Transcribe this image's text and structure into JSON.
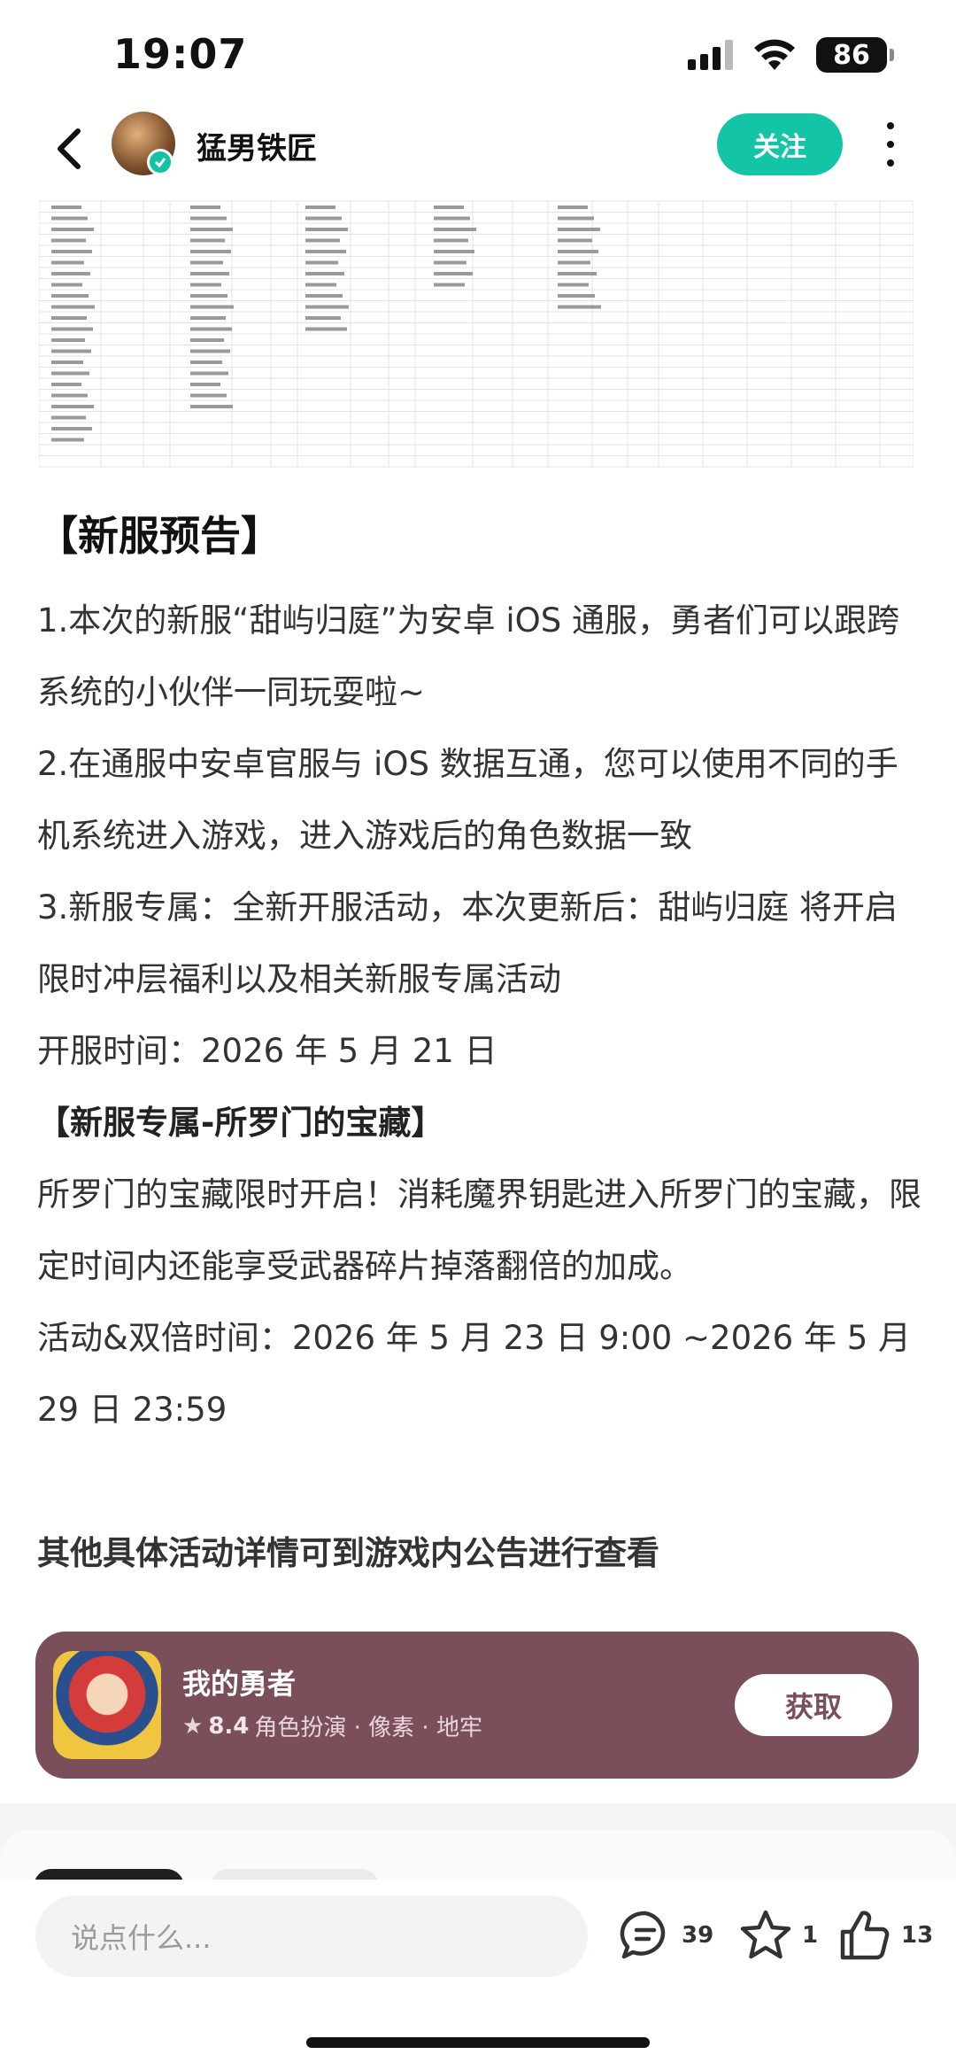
{
  "status_bar": {
    "time": "19:07",
    "battery": "86",
    "icons": [
      "signal-icon",
      "wifi-icon",
      "battery-icon"
    ]
  },
  "header": {
    "author": "猛男铁匠",
    "follow_label": "关注",
    "icons": [
      "back-icon",
      "verified-icon",
      "more-icon"
    ]
  },
  "article": {
    "section1_title": "【新服预告】",
    "p1": "1.本次的新服“甜屿归庭”为安卓 iOS 通服，勇者们可以跟跨系统的小伙伴一同玩耍啦~",
    "p2": "2.在通服中安卓官服与 iOS 数据互通，您可以使用不同的手机系统进入游戏，进入游戏后的角色数据一致",
    "p3": "3.新服专属：全新开服活动，本次更新后：甜屿归庭  将开启限时冲层福利以及相关新服专属活动",
    "open_time": "开服时间：2026 年 5 月 21 日",
    "section2_title": "【新服专属-所罗门的宝藏】",
    "p4": "所罗门的宝藏限时开启！消耗魔界钥匙进入所罗门的宝藏，限定时间内还能享受武器碎片掉落翻倍的加成。",
    "event_time": "活动&双倍时间：2026 年 5 月 23 日 9:00 ~2026 年 5 月 29 日 23:59",
    "tail": "其他具体活动详情可到游戏内公告进行查看"
  },
  "game_card": {
    "name": "我的勇者",
    "rating": "8.4",
    "tags": "角色扮演 · 像素 · 地牢",
    "get_label": "获取",
    "colors": {
      "card": "#7b4f5a"
    }
  },
  "bottom_bar": {
    "placeholder": "说点什么...",
    "comments": "39",
    "favorites": "1",
    "likes": "13",
    "icons": [
      "comment-icon",
      "star-icon",
      "thumb-up-icon"
    ]
  },
  "colors": {
    "accent": "#14c4a7"
  }
}
